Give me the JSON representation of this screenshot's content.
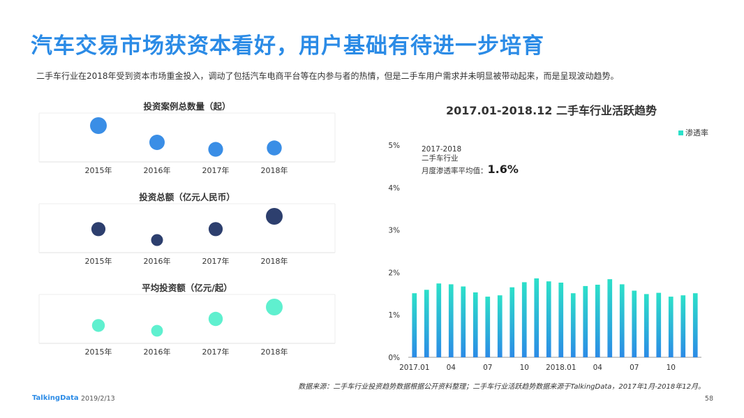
{
  "title": "汽车交易市场获资本看好，用户基础有待进一步培育",
  "subtitle": "二手车行业在2018年受到资本市场重金投入，调动了包括汽车电商平台等在内参与者的热情，但是二手车用户需求并未明显被带动起来，而是呈现波动趋势。",
  "source": "数据来源：二手车行业投资趋势数据根据公开资料整理；二手车行业活跃趋势数据来源于TalkingData，2017年1月-2018年12月。",
  "footer": {
    "logo": "TalkingData",
    "date": "2019/2/13",
    "page": "58"
  },
  "annotation": {
    "line1": "2017-2018",
    "line2": "二手车行业",
    "line3": "月度渗透率平均值：",
    "value": "1.6%"
  },
  "colors": {
    "title": "#2b8be6",
    "bubble1": "#3a8ee6",
    "bubble2": "#2d3f6e",
    "bubble3": "#5ff0cf",
    "bar_top": "#2ce0c9",
    "bar_bottom": "#2b8be6"
  },
  "chart_data": [
    {
      "type": "scatter",
      "title": "投资案例总数量（起）",
      "categories": [
        "2015年",
        "2016年",
        "2017年",
        "2018年"
      ],
      "values": [
        60,
        48,
        43,
        44
      ],
      "color_key": "bubble1"
    },
    {
      "type": "scatter",
      "title": "投资总额（亿元人民币）",
      "categories": [
        "2015年",
        "2016年",
        "2017年",
        "2018年"
      ],
      "values": [
        68,
        32,
        68,
        110
      ],
      "color_key": "bubble2"
    },
    {
      "type": "scatter",
      "title": "平均投资额（亿元/起）",
      "categories": [
        "2015年",
        "2016年",
        "2017年",
        "2018年"
      ],
      "values": [
        1.1,
        0.7,
        1.6,
        2.5
      ],
      "color_key": "bubble3"
    },
    {
      "type": "bar",
      "title": "2017.01-2018.12  二手车行业活跃趋势",
      "legend": [
        "渗透率"
      ],
      "legend_position": "top-right",
      "x": [
        "2017.01",
        "02",
        "03",
        "04",
        "05",
        "06",
        "07",
        "08",
        "09",
        "10",
        "11",
        "12",
        "2018.01",
        "02",
        "03",
        "04",
        "05",
        "06",
        "07",
        "08",
        "09",
        "10",
        "11",
        "12"
      ],
      "xtick_labels": [
        "2017.01",
        "",
        "",
        "04",
        "",
        "",
        "07",
        "",
        "",
        "10",
        "",
        "",
        "2018.01",
        "",
        "",
        "04",
        "",
        "",
        "07",
        "",
        "",
        "10",
        "",
        ""
      ],
      "values": [
        1.51,
        1.59,
        1.74,
        1.72,
        1.67,
        1.53,
        1.43,
        1.46,
        1.65,
        1.77,
        1.86,
        1.79,
        1.76,
        1.51,
        1.68,
        1.71,
        1.84,
        1.72,
        1.57,
        1.49,
        1.52,
        1.43,
        1.46,
        1.51
      ],
      "yticks": [
        "0%",
        "1%",
        "2%",
        "3%",
        "4%",
        "5%"
      ],
      "ylim": [
        0,
        5
      ],
      "grid": false
    }
  ]
}
